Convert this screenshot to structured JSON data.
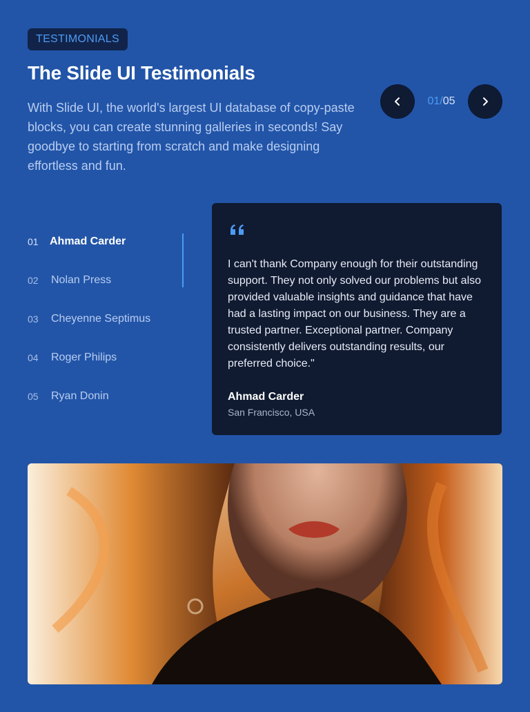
{
  "badge": "TESTIMONIALS",
  "title": "The Slide UI Testimonials",
  "description": "With Slide UI, the world's largest UI database of copy-paste blocks, you can create stunning galleries in seconds! Say goodbye to starting from scratch and make designing effortless and fun.",
  "pager": {
    "current": "01",
    "separator": "/",
    "total": "05"
  },
  "testimonials": [
    {
      "num": "01",
      "name": "Ahmad Carder"
    },
    {
      "num": "02",
      "name": "Nolan Press"
    },
    {
      "num": "03",
      "name": "Cheyenne Septimus"
    },
    {
      "num": "04",
      "name": "Roger Philips"
    },
    {
      "num": "05",
      "name": "Ryan Donin"
    }
  ],
  "active_card": {
    "quote": "I can't thank Company enough for their outstanding support. They not only solved our problems but also provided valuable insights and guidance that have had a lasting impact on our business. They are a trusted partner. Exceptional partner. Company consistently delivers outstanding results, our preferred choice.\"",
    "author": "Ahmad Carder",
    "location": "San Francisco, USA"
  },
  "icons": {
    "prev": "chevron-left-icon",
    "next": "chevron-right-icon",
    "quote": "quote-mark-icon"
  },
  "colors": {
    "background": "#2255a8",
    "accent": "#4c9bf3",
    "card": "#101a30"
  }
}
